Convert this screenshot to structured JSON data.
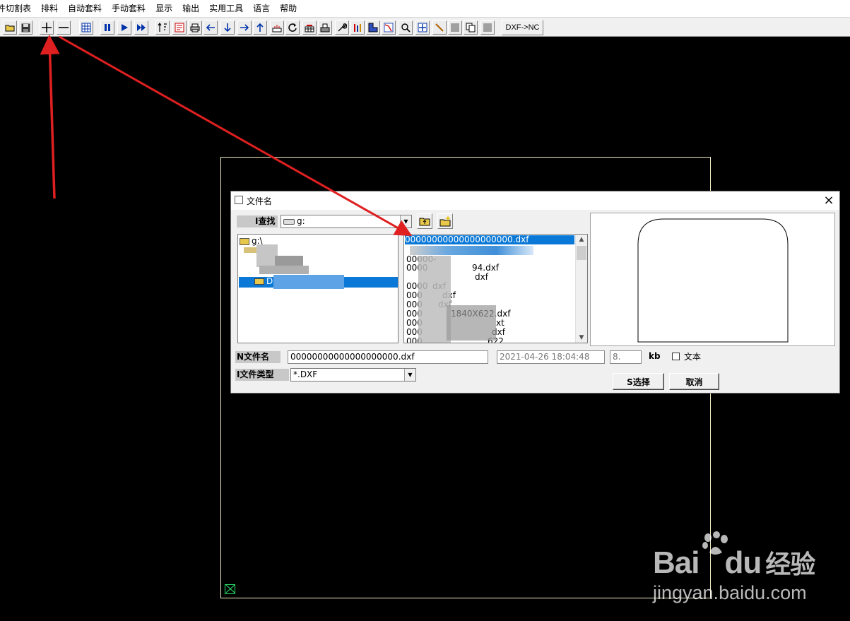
{
  "menu": [
    "件切割表",
    "排料",
    "自动套料",
    "手动套料",
    "显示",
    "输出",
    "实用工具",
    "语言",
    "帮助"
  ],
  "toolbar": {
    "dxf_nc_label": "DXF->NC",
    "icons": [
      "open-icon",
      "save-icon",
      "zoom-in-plus-icon",
      "zoom-out-minus-icon",
      "grid-icon",
      "pause-icon",
      "play-icon",
      "fast-forward-icon",
      "sort-icon",
      "nc-icon",
      "print-icon",
      "arrow-left-icon",
      "arrow-down-icon",
      "arrow-right-icon",
      "arrow-up-icon",
      "measure-icon",
      "rotate-icon",
      "table-icon",
      "stack-icon",
      "wrench-icon",
      "bars-icon",
      "shape-icon",
      "cut-path-icon",
      "zoom-window-icon",
      "zoom-all-icon",
      "line-icon",
      "blank-icon",
      "copy-icon",
      "stop-icon"
    ]
  },
  "dialog": {
    "title": "文件名",
    "close": "×",
    "lookin_label": "I查找",
    "lookin_value": "g:",
    "tree": [
      "g:\\",
      "DX"
    ],
    "files": [
      "00000000000000000000.dxf",
      "00000-",
      "0000",
      "94.dxf",
      "dxf",
      "0000",
      "dxf",
      "000",
      "dxf",
      "000",
      "dxf",
      "000",
      "1840X622.dxf",
      "000",
      "xt",
      "000",
      "dxf",
      "000",
      "622"
    ],
    "filename_label": "N文件名",
    "filename_value": "00000000000000000000.dxf",
    "filetype_label": "I文件类型",
    "filetype_value": "*.DXF",
    "date_value": "2021-04-26 18:04:48",
    "size_value": "8.",
    "size_unit": "kb",
    "text_checkbox_label": "文本",
    "select_button": "S选择",
    "cancel_button": "取消"
  },
  "watermark": {
    "brand": "Bai",
    "brand_du": "du",
    "brand_cn": "经验",
    "url": "jingyan.baidu.com"
  }
}
